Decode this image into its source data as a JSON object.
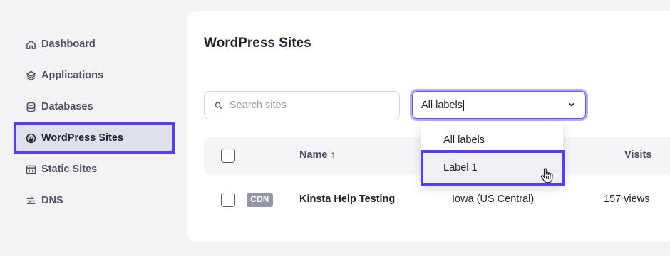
{
  "sidebar": {
    "items": [
      {
        "label": "Dashboard",
        "icon": "home-icon"
      },
      {
        "label": "Applications",
        "icon": "layers-icon"
      },
      {
        "label": "Databases",
        "icon": "database-icon"
      },
      {
        "label": "WordPress Sites",
        "icon": "wordpress-icon",
        "active": true
      },
      {
        "label": "Static Sites",
        "icon": "static-site-icon"
      },
      {
        "label": "DNS",
        "icon": "dns-icon"
      }
    ]
  },
  "main": {
    "title": "WordPress Sites",
    "search": {
      "placeholder": "Search sites",
      "value": ""
    },
    "label_filter": {
      "selected": "All labels",
      "options": [
        "All labels",
        "Label 1"
      ],
      "highlighted": "Label 1"
    },
    "table": {
      "columns": {
        "name": "Name ↑",
        "visits": "Visits"
      },
      "rows": [
        {
          "badge": "CDN",
          "name": "Kinsta Help Testing",
          "location": "Iowa (US Central)",
          "visits": "157 views"
        }
      ]
    }
  },
  "colors": {
    "accent": "#5b3cf0",
    "background": "#f3f3f6",
    "badge": "#9697a6"
  }
}
